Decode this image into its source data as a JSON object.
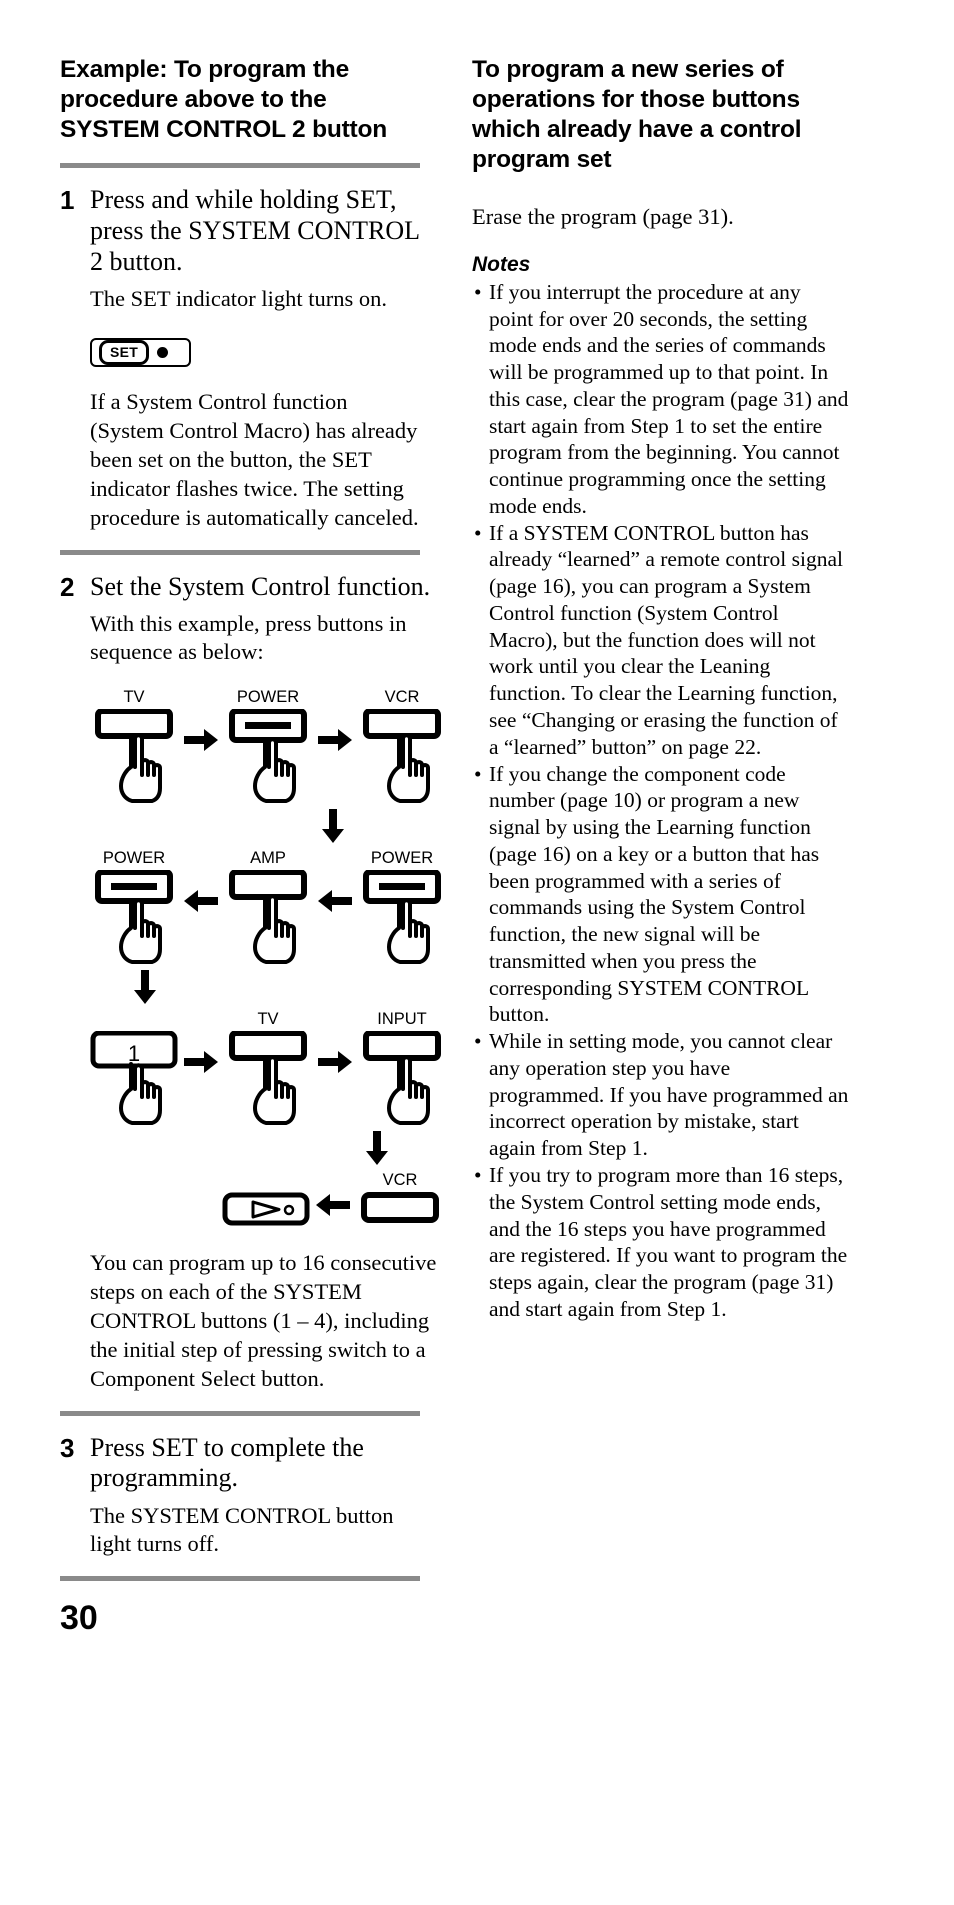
{
  "page": {
    "number": "30"
  },
  "left_column": {
    "heading": "Example: To program the procedure above to the SYSTEM CONTROL 2 button",
    "steps": [
      {
        "num": "1",
        "title": "Press and while holding SET, press the SYSTEM CONTROL 2 button.",
        "sub": "The SET indicator light turns on.",
        "indicator": {
          "label": "SET",
          "led": "led-dot"
        },
        "para": "If a System Control function (System Control Macro) has already been set on the button, the SET indicator flashes twice. The setting procedure is automatically canceled."
      },
      {
        "num": "2",
        "title": "Set the System Control function.",
        "sub": "With this example, press buttons in sequence as below:",
        "para": "You can program up to 16 consecutive steps on each of the SYSTEM CONTROL buttons (1 – 4), including the initial step of pressing switch to a Component Select button."
      },
      {
        "num": "3",
        "title": "Press SET to complete the programming.",
        "sub": "The SYSTEM CONTROL button light turns off."
      }
    ],
    "sequence": {
      "row1": [
        {
          "label": "TV",
          "type": "plain",
          "inner": ""
        },
        {
          "arrow": "right"
        },
        {
          "label": "POWER",
          "type": "bar",
          "inner": ""
        },
        {
          "arrow": "right"
        },
        {
          "label": "VCR",
          "type": "plain",
          "inner": ""
        }
      ],
      "down1": "down",
      "row2": [
        {
          "label": "POWER",
          "type": "bar",
          "inner": ""
        },
        {
          "arrow": "left"
        },
        {
          "label": "AMP",
          "type": "plain",
          "inner": ""
        },
        {
          "arrow": "left"
        },
        {
          "label": "POWER",
          "type": "bar",
          "inner": ""
        }
      ],
      "down2": "down",
      "row3": [
        {
          "label": "",
          "type": "numbered",
          "inner": "1"
        },
        {
          "arrow": "right"
        },
        {
          "label": "TV",
          "type": "plain",
          "inner": ""
        },
        {
          "arrow": "right"
        },
        {
          "label": "INPUT",
          "type": "plain",
          "inner": ""
        }
      ],
      "down3": "down",
      "row4": [
        {
          "label": "",
          "type": "play",
          "inner": ""
        },
        {
          "arrow": "left"
        },
        {
          "label": "VCR",
          "type": "plain",
          "inner": ""
        }
      ]
    }
  },
  "right_column": {
    "heading": "To program a new series of operations for those buttons which already have a control program set",
    "intro": "Erase the program (page 31).",
    "notes_title": "Notes",
    "notes": [
      "If you interrupt the procedure at any point for over 20 seconds, the setting mode ends and the series of commands will be programmed up to that point. In this case, clear the program (page 31) and start again from Step 1 to set the entire program from the beginning. You cannot continue programming once the setting mode ends.",
      "If a SYSTEM CONTROL button has already “learned” a remote control signal (page 16), you can program a System Control function (System Control Macro), but the function does will not work until you clear the Leaning function. To clear the Learning function, see “Changing or erasing the function of a “learned” button” on page 22.",
      "If you change the component code number (page 10) or program a new signal by using the Learning function (page 16) on a key or a button that has been programmed with a series of commands using the System Control function, the new signal will be transmitted when you press the corresponding SYSTEM CONTROL button.",
      "While in setting mode, you cannot clear any operation step you have programmed. If you have programmed an incorrect operation by mistake, start again from Step 1.",
      "If you try to program more than 16 steps, the System Control setting mode ends, and the 16 steps you have programmed are registered. If you want to program the steps again, clear the program (page 31) and start again from Step 1."
    ]
  },
  "colors": {
    "rule": "#8a8a8a",
    "text": "#000000",
    "background": "#ffffff"
  }
}
